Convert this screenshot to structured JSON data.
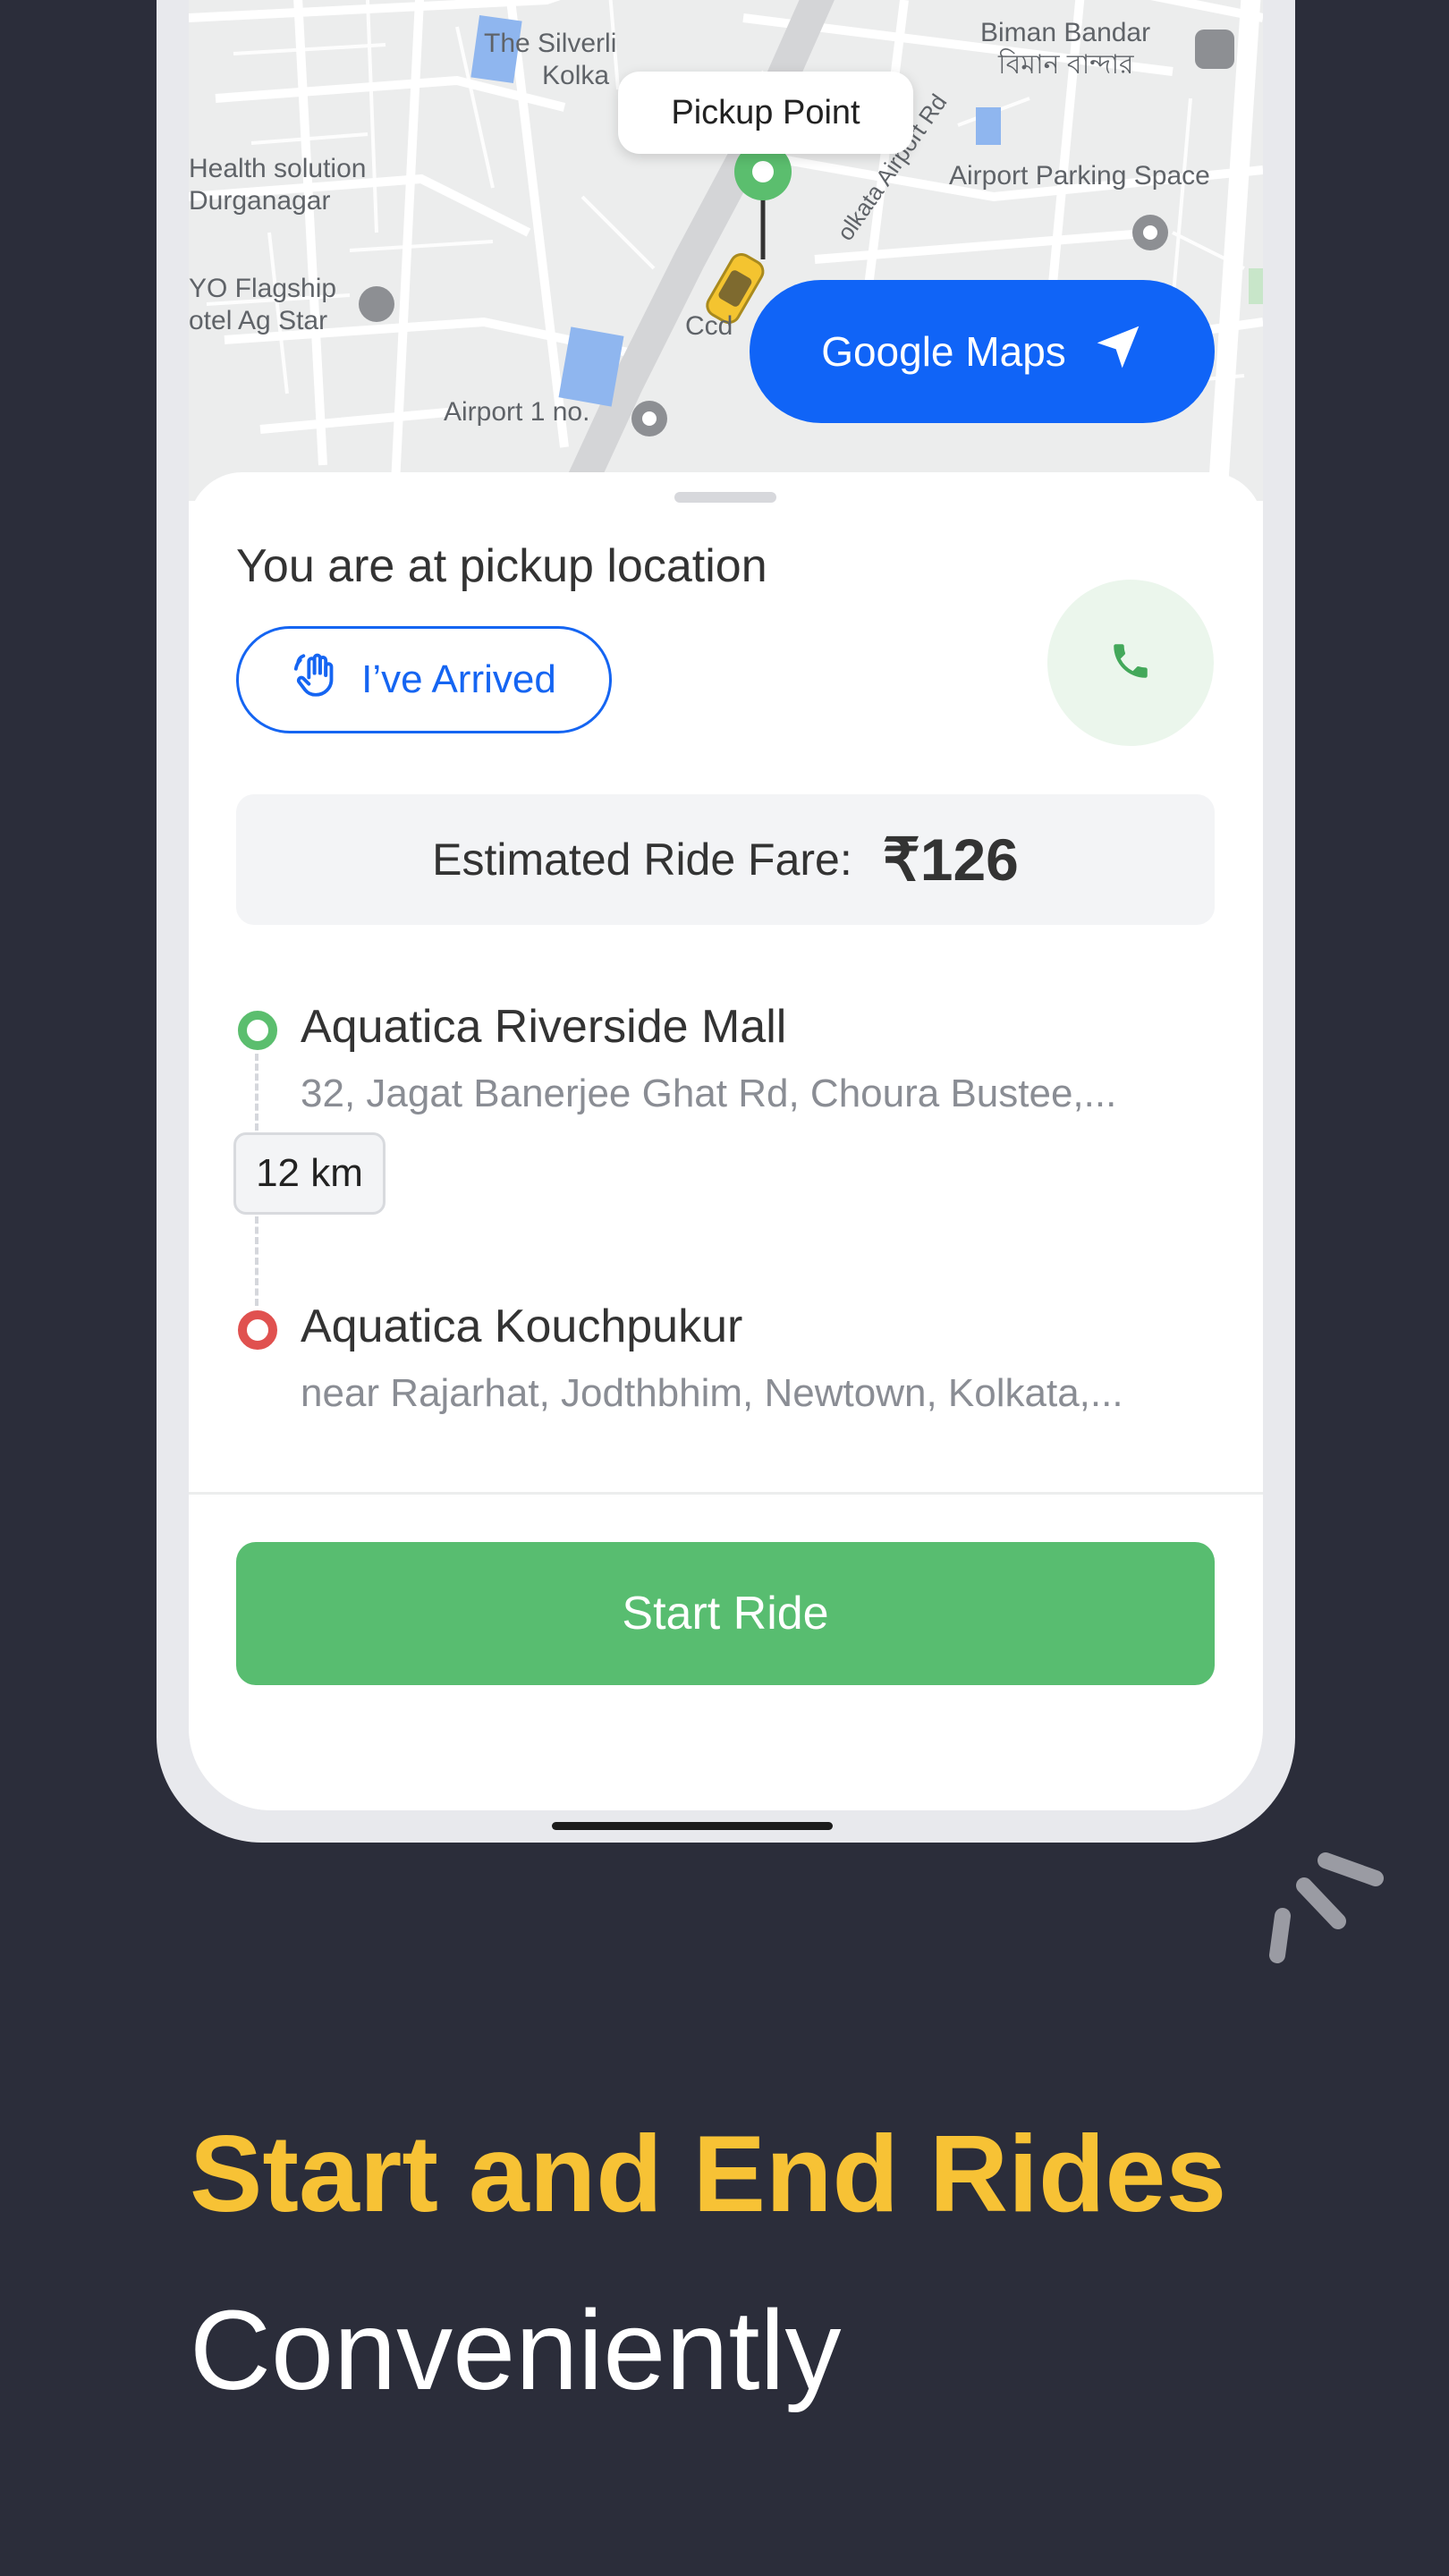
{
  "map": {
    "pickup_label": "Pickup Point",
    "google_maps_label": "Google Maps",
    "places": [
      "The Silverli",
      "Kolka",
      "Biman Bandar",
      "বিমান বান্দার",
      "Health solution",
      "Durganagar",
      "Airport Parking Space",
      "YO Flagship",
      "otel Ag Star",
      "Airport 1 no.",
      "olkata Airport Rd",
      "Ccd"
    ]
  },
  "sheet": {
    "pickup_title": "You are at pickup location",
    "arrived_label": "I’ve Arrived",
    "fare_label": "Estimated Ride Fare:",
    "fare_value": "₹126",
    "distance": "12 km",
    "start_label": "Start Ride",
    "pickup_stop": {
      "name": "Aquatica Riverside Mall",
      "address": "32, Jagat Banerjee Ghat Rd, Choura Bustee,..."
    },
    "drop_stop": {
      "name": "Aquatica Kouchpukur",
      "address": "near Rajarhat, Jodthbhim, Newtown, Kolkata,..."
    }
  },
  "promo": {
    "headline": "Start and End Rides",
    "subline": "Conveniently"
  },
  "colors": {
    "background": "#2b2d3a",
    "accent_blue": "#1064f7",
    "accent_green": "#58bd70",
    "headline_yellow": "#f7c235",
    "drop_red": "#e0514f"
  },
  "icons": {
    "arrived": "hand-wave-icon",
    "call": "phone-icon",
    "google_maps": "navigation-arrow-icon"
  }
}
